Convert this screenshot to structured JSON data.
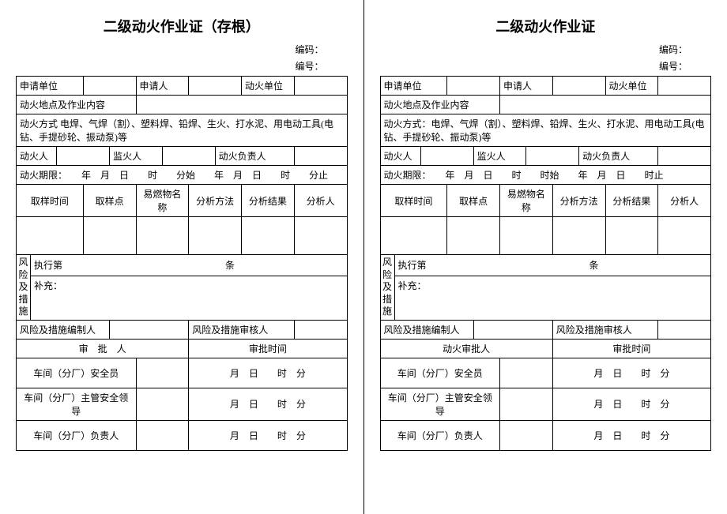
{
  "left": {
    "title": "二级动火作业证（存根）",
    "code_label": "编码：",
    "number_label": "编号：",
    "apply_unit": "申请单位",
    "applicant": "申请人",
    "fire_unit": "动火单位",
    "location_content": "动火地点及作业内容",
    "method": "动火方式 电焊、气焊（割）、塑料焊、铅焊、生火、打水泥、用电动工具(电钻、手提砂轮、振动泵)等",
    "fire_person": "动火人",
    "supervisor": "监火人",
    "fire_responsible": "动火负责人",
    "period": "动火期限：　　年　月　日　　时　　分始　　年　月　日　　时　　分止",
    "sample_time": "取样时间",
    "sample_point": "取样点",
    "flammable": "易燃物名称",
    "analysis_method": "分析方法",
    "analysis_result": "分析结果",
    "analyst": "分析人",
    "risk_label": "风险及措施",
    "exec_clause_pre": "执行第",
    "exec_clause_suf": "条",
    "supplement": "补充：",
    "risk_compiler": "风险及措施编制人",
    "risk_reviewer": "风险及措施审核人",
    "approver_col": "审　批　人",
    "approve_time_col": "审批时间",
    "rows": [
      {
        "role": "车间（分厂）安全员",
        "time": "月　日　　时　分"
      },
      {
        "role": "车间（分厂）主管安全领导",
        "time": "月　日　　时　分"
      },
      {
        "role": "车间（分厂）负责人",
        "time": "月　日　　时　分"
      }
    ]
  },
  "right": {
    "title": "二级动火作业证",
    "code_label": "编码：",
    "number_label": "编号：",
    "apply_unit": "申请单位",
    "applicant": "申请人",
    "fire_unit": "动火单位",
    "location_content": "动火地点及作业内容",
    "method": "动火方式：电焊、气焊（割）、塑料焊、铅焊、生火、打水泥、用电动工具(电钻、手提砂轮、振动泵)等",
    "fire_person": "动火人",
    "supervisor": "监火人",
    "fire_responsible": "动火负责人",
    "period": "动火期限：　　年　月　日　　时　　时始　　年　月　日　　时止",
    "sample_time": "取样时间",
    "sample_point": "取样点",
    "flammable": "易燃物名称",
    "analysis_method": "分析方法",
    "analysis_result": "分析结果",
    "analyst": "分析人",
    "risk_label": "风险及措施",
    "exec_clause_pre": "执行第",
    "exec_clause_suf": "条",
    "supplement": "补充：",
    "risk_compiler": "风险及措施编制人",
    "risk_reviewer": "风险及措施审核人",
    "approver_col": "动火审批人",
    "approve_time_col": "审批时间",
    "rows": [
      {
        "role": "车间（分厂）安全员",
        "time": "月　日　　时　分"
      },
      {
        "role": "车间（分厂）主管安全领导",
        "time": "月　日　　时　分"
      },
      {
        "role": "车间（分厂）负责人",
        "time": "月　日　　时　分"
      }
    ]
  }
}
